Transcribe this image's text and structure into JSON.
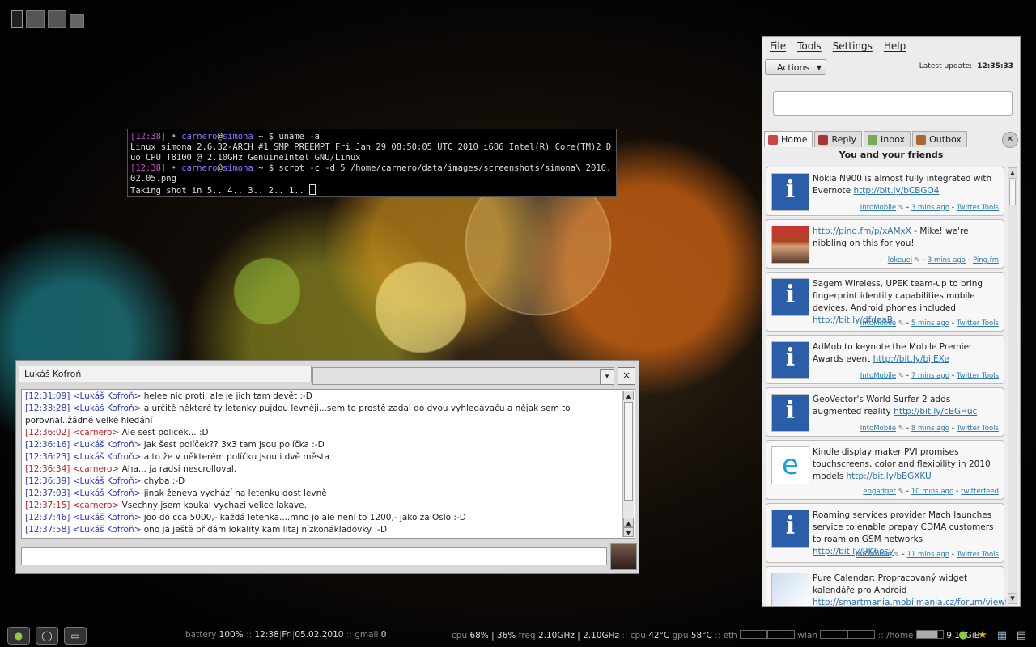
{
  "terminal": {
    "lines": [
      {
        "time": "[12:38]",
        "dot": "•",
        "user": "carnero",
        "at": "@",
        "host": "simona",
        "prompt": " ~ $ ",
        "cmd": "uname -a"
      },
      {
        "output": "Linux simona 2.6.32-ARCH #1 SMP PREEMPT Fri Jan 29 08:50:05 UTC 2010 i686 Intel(R) Core(TM)2 Duo CPU T8100 @ 2.10GHz GenuineIntel GNU/Linux"
      },
      {
        "time": "[12:38]",
        "dot": "•",
        "user": "carnero",
        "at": "@",
        "host": "simona",
        "prompt": " ~ $ ",
        "cmd": "scrot -c -d 5 /home/carnero/data/images/screenshots/simona\\ 2010.02.05.png"
      },
      {
        "output": "Taking shot in 5.. 4.. 3.. 2.. 1.. "
      }
    ]
  },
  "chat": {
    "tab_title": "Lukáš Kofroň",
    "close_glyph": "×",
    "dropdown_glyph": "▾",
    "messages": [
      {
        "ts": "[12:31:09]",
        "nick": "<Lukáš Kofroň>",
        "text": "helee nic proti, ale je jich tam devět :-D",
        "self": false
      },
      {
        "ts": "[12:33:28]",
        "nick": "<Lukáš Kofroň>",
        "text": "a určitě některé ty letenky pujdou levněji...sem to prostě zadal do dvou vyhledávaču a nějak sem to porovnal..žádné velké hledání",
        "self": false
      },
      {
        "ts": "[12:36:02]",
        "nick": "<carnero>",
        "text": "Ale sest policek... :D",
        "self": true
      },
      {
        "ts": "[12:36:16]",
        "nick": "<Lukáš Kofroň>",
        "text": "jak šest políček?? 3x3 tam jsou políčka :-D",
        "self": false
      },
      {
        "ts": "[12:36:23]",
        "nick": "<Lukáš Kofroň>",
        "text": "a to že v některém políčku jsou i dvě města",
        "self": false
      },
      {
        "ts": "[12:36:34]",
        "nick": "<carnero>",
        "text": "Aha... ja radsi nescrolloval.",
        "self": true
      },
      {
        "ts": "[12:36:39]",
        "nick": "<Lukáš Kofroň>",
        "text": "chyba :-D",
        "self": false
      },
      {
        "ts": "[12:37:03]",
        "nick": "<Lukáš Kofroň>",
        "text": "jinak ženeva vychází na letenku dost levně",
        "self": false
      },
      {
        "ts": "[12:37:15]",
        "nick": "<carnero>",
        "text": "Vsechny jsem koukal vychazi velice lakave.",
        "self": true
      },
      {
        "ts": "[12:37:46]",
        "nick": "<Lukáš Kofroň>",
        "text": "joo do cca 5000,- každá letenka....mno jo ale není to 1200,- jako za Oslo :-D",
        "self": false
      },
      {
        "ts": "[12:37:58]",
        "nick": "<Lukáš Kofroň>",
        "text": "ono já ještě přidám lokality kam litaj nízkonákladovky :-D",
        "self": false
      }
    ]
  },
  "twitter": {
    "menu": [
      "File",
      "Tools",
      "Settings",
      "Help"
    ],
    "actions_label": "Actions",
    "latest_label": "Latest update:",
    "latest_time": "12:35:33",
    "tabs": [
      {
        "label": "Home",
        "color": "#c44"
      },
      {
        "label": "Reply",
        "color": "#a33"
      },
      {
        "label": "Inbox",
        "color": "#7a5"
      },
      {
        "label": "Outbox",
        "color": "#a63"
      }
    ],
    "heading": "You and your friends",
    "tweets": [
      {
        "avatar": "info",
        "text": "Nokia N900 is almost fully integrated with Evernote ",
        "link": "http://bit.ly/bCBGO4",
        "user": "IntoMobile",
        "time": "3 mins ago",
        "source": "Twitter Tools",
        "tall": false
      },
      {
        "avatar": "photo",
        "text": " - Mike! we're nibbling on this for you!",
        "link_first": "http://ping.fm/p/xAMxX",
        "user": "lokeuei",
        "time": "3 mins ago",
        "source": "Ping.fm",
        "tall": false
      },
      {
        "avatar": "info",
        "text": "Sagem Wireless, UPEK team-up to bring fingerprint identity capabilities mobile devices, Android phones included ",
        "link": "http://bit.ly/dfdeaB",
        "user": "IntoMobile",
        "time": "5 mins ago",
        "source": "Twitter Tools",
        "tall": true
      },
      {
        "avatar": "info",
        "text": "AdMob to keynote the Mobile Premier Awards event ",
        "link": "http://bit.ly/bjlEXe",
        "user": "IntoMobile",
        "time": "7 mins ago",
        "source": "Twitter Tools",
        "tall": false
      },
      {
        "avatar": "info",
        "text": "GeoVector's World Surfer 2 adds augmented reality ",
        "link": "http://bit.ly/cBGHuc",
        "user": "IntoMobile",
        "time": "8 mins ago",
        "source": "Twitter Tools",
        "tall": false
      },
      {
        "avatar": "engadget",
        "text": "Kindle display maker PVI promises touchscreens, color and flexibility in 2010 models ",
        "link": "http://bit.ly/bBGXKU",
        "user": "engadget",
        "time": "10 mins ago",
        "source": "twitterfeed",
        "tall": true
      },
      {
        "avatar": "info",
        "text": "Roaming services provider Mach launches service to enable prepay CDMA customers to roam on GSM networks ",
        "link": "http://bit.ly/9K6osy",
        "user": "IntoMobile",
        "time": "11 mins ago",
        "source": "Twitter Tools",
        "tall": true
      },
      {
        "avatar": "calendar",
        "text": "Pure Calendar: Propracovaný widget kalendáře pro Android ",
        "link": "http://smartmania.mobilmania.cz/forum/viewto",
        "user": "",
        "time": "",
        "source": "",
        "tall": true
      }
    ]
  },
  "panel": {
    "battery_label": "battery",
    "battery_value": "100%",
    "time": "12:38",
    "day": "Fri",
    "date": "05.02.2010",
    "gmail_label": "gmail",
    "gmail_value": "0",
    "cpu_label": "cpu",
    "cpu_values": "68% | 36%",
    "freq_label": "freq",
    "freq_values": "2.10GHz | 2.10GHz",
    "cpu_temp_label": "cpu",
    "cpu_temp": "42°C",
    "gpu_label": "gpu",
    "gpu_temp": "58°C",
    "eth_label": "eth",
    "wlan_label": "wlan",
    "home_label": "/home",
    "home_value": "9.14GiB",
    "sep": "::"
  }
}
